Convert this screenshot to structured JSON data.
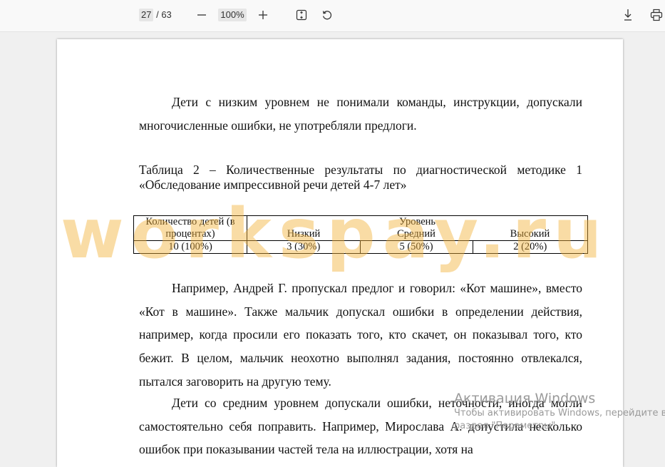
{
  "toolbar": {
    "page_current": "27",
    "page_total": "/ 63",
    "zoom": "100%",
    "icons": [
      "minus-icon",
      "plus-icon",
      "fit-page-icon",
      "rotate-icon",
      "download-icon",
      "print-icon"
    ]
  },
  "document": {
    "para1": "Дети с низким уровнем не понимали команды, инструкции, допускали многочисленные ошибки, не употребляли предлоги.",
    "caption": "Таблица 2 – Количественные результаты по диагностической методике 1 «Обследование импрессивной речи детей 4-7 лет»",
    "table": {
      "header_col1": "Количество детей (в процентах)",
      "header_group": "Уровень",
      "levels": [
        "Низкий",
        "Средний",
        "Высокий"
      ],
      "total": "10 (100%)",
      "values": [
        "3 (30%)",
        "5 (50%)",
        "2 (20%)"
      ]
    },
    "para2": "Например, Андрей Г. пропускал предлог и говорил: «Кот машине», вместо «Кот в машине». Также мальчик допускал ошибки в определении действия, например, когда просили его показать того, кто скачет, он показывал того, кто бежит. В целом, мальчик неохотно выполнял задания, постоянно отвлекался, пытался заговорить на другую тему.",
    "para3": "Дети со средним уровнем допускали ошибки, неточности, иногда могли самостоятельно себя поправить. Например, Мирослава А. допустила несколько ошибок при показывании частей тела на иллюстрации, хотя на"
  },
  "watermark": "workspay.ru",
  "activation": {
    "title": "Активация Windows",
    "line1": "Чтобы активировать Windows, перейдите в",
    "line2": "раздел \"Параметры\"."
  }
}
